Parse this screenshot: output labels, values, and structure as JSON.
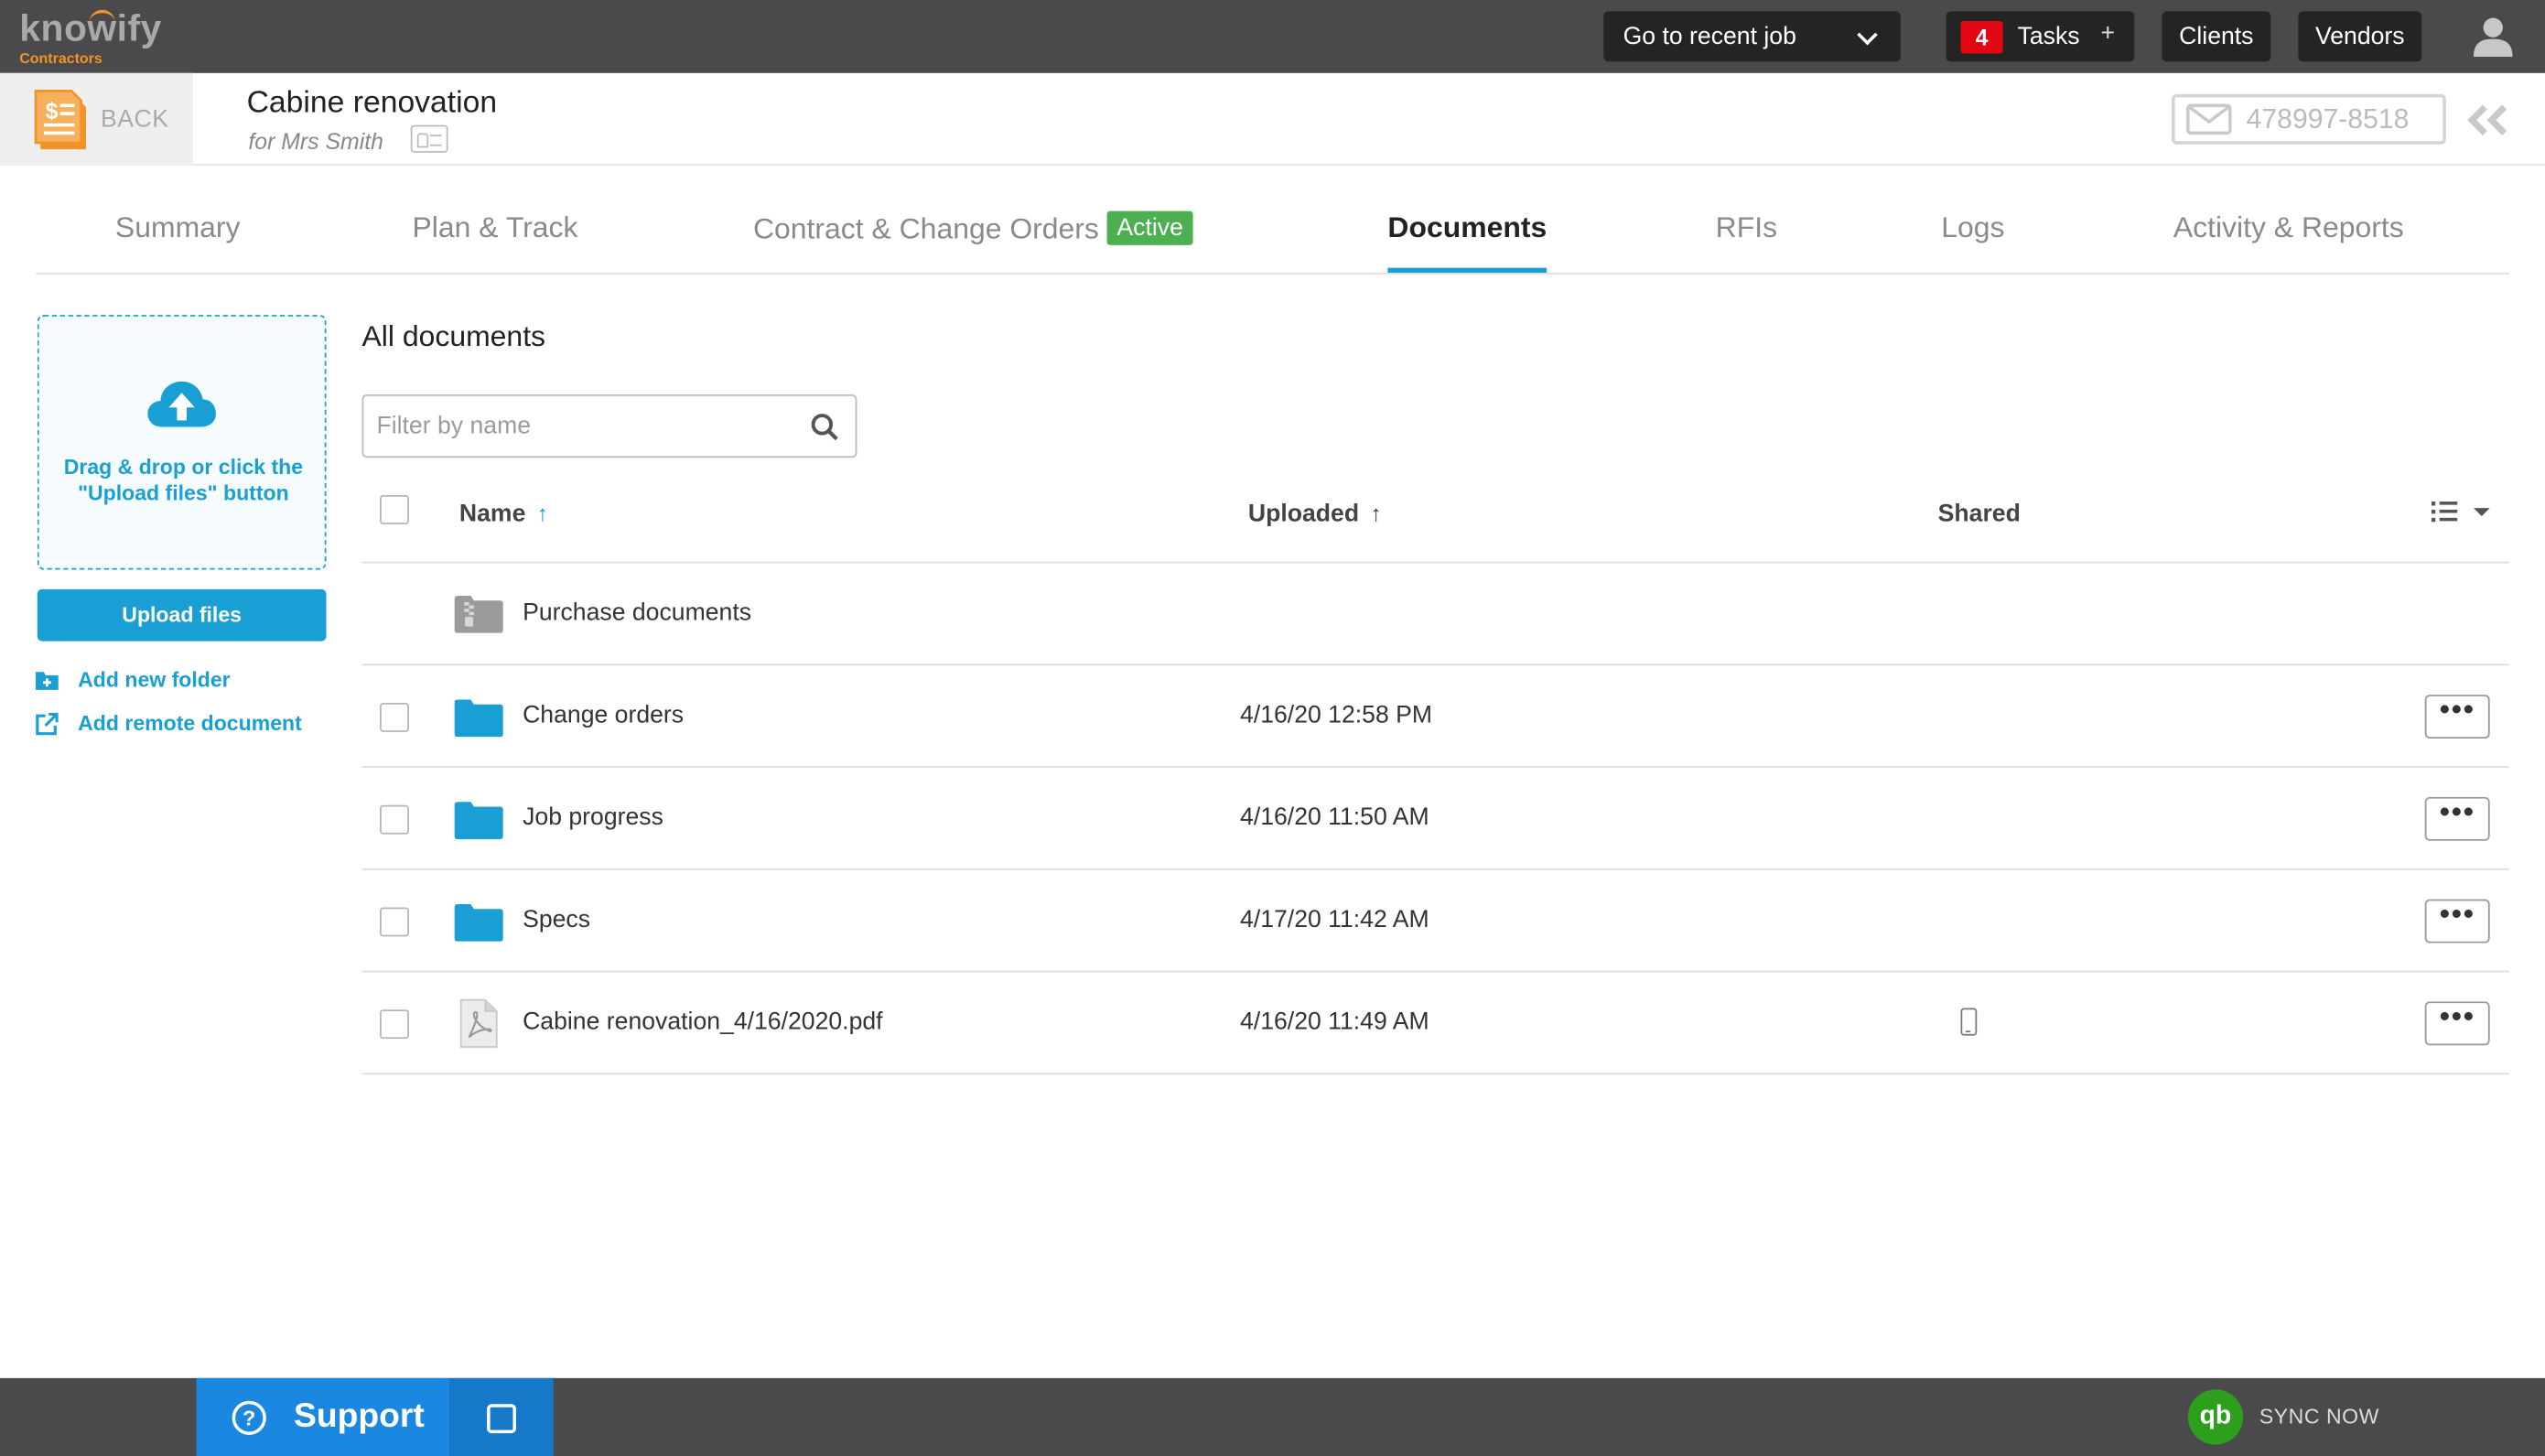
{
  "app": {
    "logo_text": "knowify",
    "logo_subtext": "Contractors"
  },
  "topbar": {
    "recent_job_label": "Go to recent job",
    "tasks_count": "4",
    "tasks_label": "Tasks",
    "tasks_add": "+",
    "clients_label": "Clients",
    "vendors_label": "Vendors"
  },
  "header": {
    "back_label": "BACK",
    "job_title": "Cabine renovation",
    "client_line": "for Mrs Smith",
    "email_number": "478997-8518"
  },
  "tabs": [
    {
      "label": "Summary"
    },
    {
      "label": "Plan & Track"
    },
    {
      "label": "Contract & Change Orders",
      "badge": "Active"
    },
    {
      "label": "Documents",
      "active": true
    },
    {
      "label": "RFIs"
    },
    {
      "label": "Logs"
    },
    {
      "label": "Activity & Reports"
    }
  ],
  "sidebar": {
    "dropzone_text": "Drag & drop or click the \"Upload files\" button",
    "upload_button": "Upload files",
    "add_folder": "Add new folder",
    "add_remote": "Add remote document"
  },
  "documents": {
    "heading": "All documents",
    "filter_placeholder": "Filter by name",
    "columns": {
      "name": "Name",
      "uploaded": "Uploaded",
      "shared": "Shared",
      "sort_arrow": "↑"
    },
    "rows": [
      {
        "name": "Purchase documents",
        "uploaded": "",
        "type": "archive-folder",
        "checkbox": false,
        "shared": false,
        "menu": false
      },
      {
        "name": "Change orders",
        "uploaded": "4/16/20 12:58 PM",
        "type": "folder",
        "checkbox": true,
        "shared": false,
        "menu": true
      },
      {
        "name": "Job progress",
        "uploaded": "4/16/20 11:50 AM",
        "type": "folder",
        "checkbox": true,
        "shared": false,
        "menu": true
      },
      {
        "name": "Specs",
        "uploaded": "4/17/20 11:42 AM",
        "type": "folder",
        "checkbox": true,
        "shared": false,
        "menu": true
      },
      {
        "name": "Cabine renovation_4/16/2020.pdf",
        "uploaded": "4/16/20 11:49 AM",
        "type": "pdf",
        "checkbox": true,
        "shared": true,
        "menu": true
      }
    ],
    "more_label": "•••"
  },
  "bottombar": {
    "support_label": "Support",
    "support_icon": "?",
    "qb_label": "qb",
    "sync_label": "SYNC NOW"
  },
  "colors": {
    "accent": "#1a9fd5",
    "topbar": "#4a4a4c",
    "active_badge": "#4caf50",
    "tasks_badge": "#e30613",
    "quickbooks": "#2ca01c",
    "back_icon": "#f39325"
  }
}
